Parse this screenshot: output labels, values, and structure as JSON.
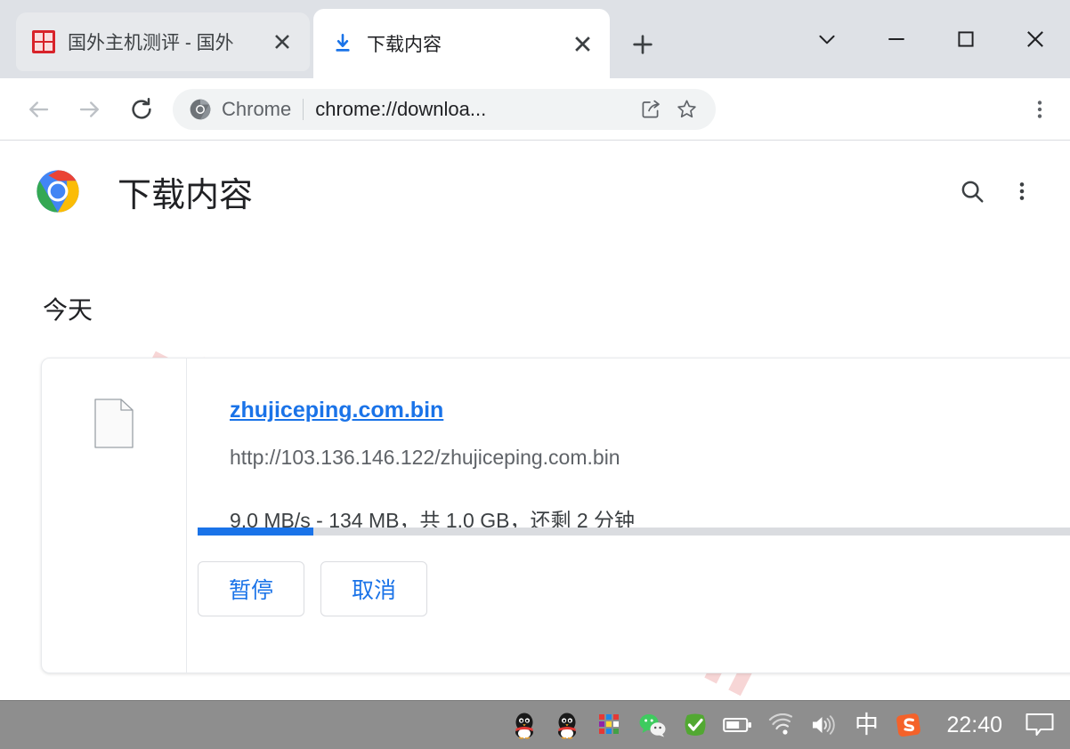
{
  "window": {
    "controls": [
      {
        "name": "tab-search",
        "glyph": "chevron-down"
      },
      {
        "name": "minimize",
        "glyph": "minimize"
      },
      {
        "name": "maximize",
        "glyph": "maximize"
      },
      {
        "name": "close",
        "glyph": "close"
      }
    ]
  },
  "tabs": [
    {
      "title": "国外主机测评 - 国外",
      "favicon": "site-favicon-red",
      "active": false
    },
    {
      "title": "下载内容",
      "favicon": "download-icon",
      "active": true
    }
  ],
  "tabstrip": {
    "new_tab_label": "+",
    "close_label": "✕"
  },
  "toolbar": {
    "back_label": "←",
    "forward_label": "→",
    "reload_label": "↻",
    "brand": "Chrome",
    "url": "chrome://downloa...",
    "url_full": "chrome://downloads",
    "share_label": "share-icon",
    "bookmark_label": "star-icon",
    "menu_label": "⋮"
  },
  "downloads_page": {
    "title": "下载内容",
    "search_label": "search-icon",
    "menu_label": "⋮",
    "section_label": "今天",
    "watermark": "zhujiceping.com",
    "item": {
      "file_name": "zhujiceping.com.bin",
      "url": "http://103.136.146.122/zhujiceping.com.bin",
      "status": "9.0 MB/s - 134 MB，共 1.0 GB，还剩 2 分钟",
      "speed": "9.0 MB/s",
      "downloaded": "134 MB",
      "total_size": "1.0 GB",
      "time_remaining": "2 分钟",
      "progress_percent": 13,
      "pause_label": "暂停",
      "cancel_label": "取消"
    }
  },
  "taskbar": {
    "tray": [
      {
        "name": "qq-icon",
        "label": "QQ"
      },
      {
        "name": "qq-icon-2",
        "label": "QQ"
      },
      {
        "name": "colorful-grid-icon",
        "label": "App"
      },
      {
        "name": "wechat-icon",
        "label": "WeChat"
      },
      {
        "name": "green-check-icon",
        "label": "Security"
      },
      {
        "name": "battery-icon",
        "label": "Battery"
      },
      {
        "name": "wifi-icon",
        "label": "Network"
      },
      {
        "name": "volume-icon",
        "label": "Volume"
      }
    ],
    "ime_label": "中",
    "sogou_label": "S",
    "clock": "22:40",
    "notification_label": "notification-icon"
  },
  "colors": {
    "accent_blue": "#1a73e8",
    "tabstrip_bg": "#dee1e6",
    "taskbar_bg": "#8e8e8e",
    "watermark": "#f2b6b6"
  }
}
